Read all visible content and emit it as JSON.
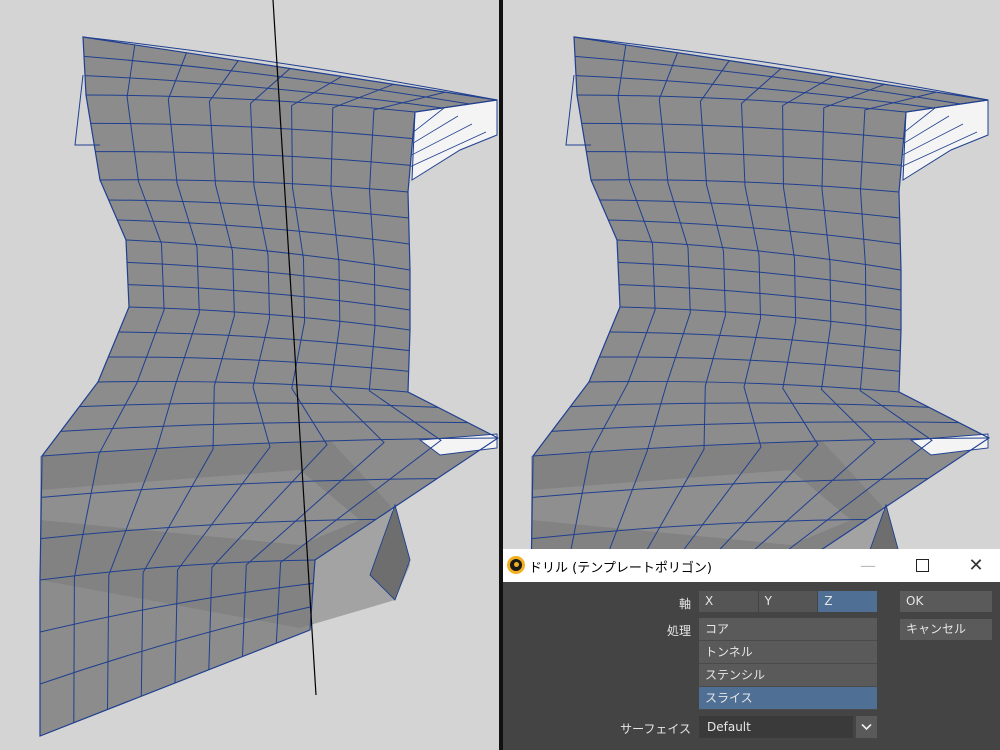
{
  "dialog": {
    "title": "ドリル (テンプレートポリゴン)",
    "axis_label": "軸",
    "axis_options": [
      "X",
      "Y",
      "Z"
    ],
    "axis_selected": "Z",
    "ok_label": "OK",
    "cancel_label": "キャンセル",
    "operation_label": "処理",
    "operations": [
      "コア",
      "トンネル",
      "ステンシル",
      "スライス"
    ],
    "operation_selected": "スライス",
    "surface_label": "サーフェイス",
    "surface_value": "Default",
    "minimize_glyph": "—",
    "close_glyph": "✕"
  },
  "colors": {
    "viewport_bg": "#d4d4d4",
    "mesh_fill": "#8c8c8c",
    "wireframe": "#1f3f8f",
    "dialog_bg": "#444444",
    "accent": "#4f6f95"
  }
}
